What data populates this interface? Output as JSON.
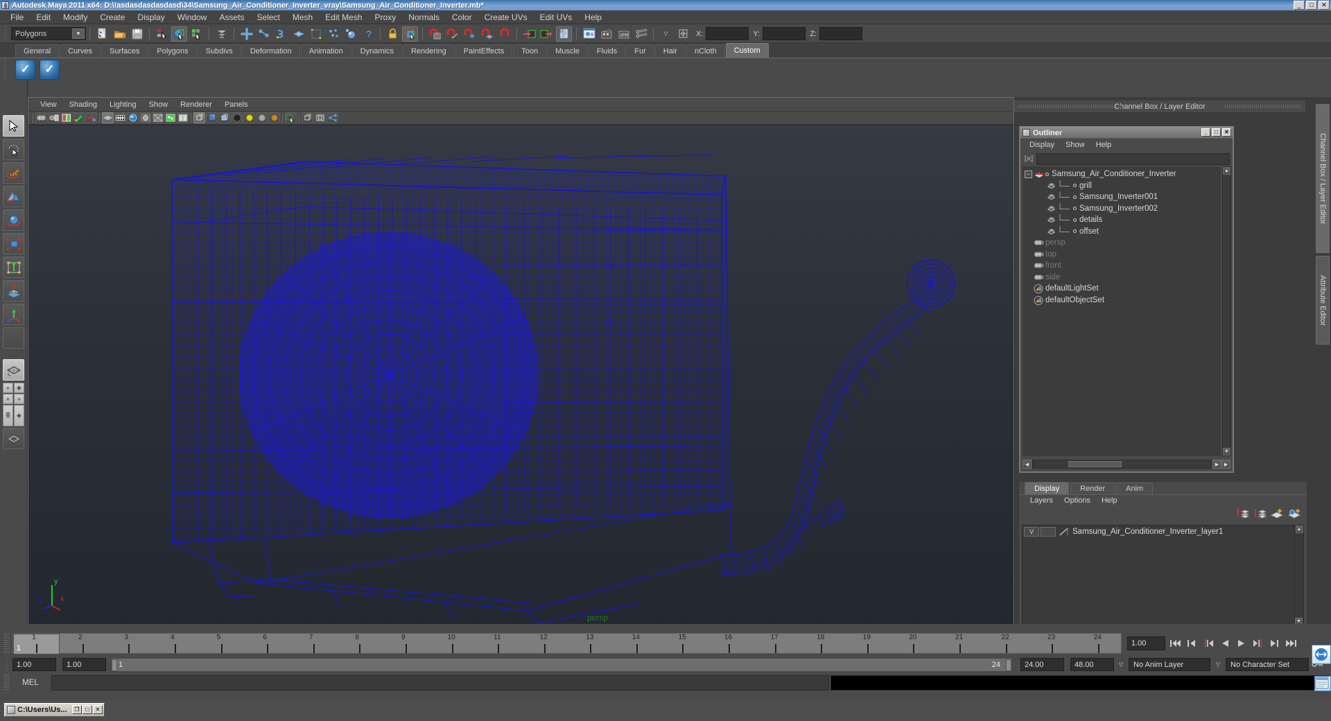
{
  "window": {
    "title": "Autodesk Maya 2011 x64: D:\\!asdasdasdasdasd\\34\\Samsung_Air_Conditioner_Inverter_vray\\Samsung_Air_Conditioner_Inverter.mb*",
    "minimize": "_",
    "maximize": "□",
    "close": "✕",
    "titlebar_color": "#4a7fb5"
  },
  "menubar": {
    "items": [
      "File",
      "Edit",
      "Modify",
      "Create",
      "Display",
      "Window",
      "Assets",
      "Select",
      "Mesh",
      "Edit Mesh",
      "Proxy",
      "Normals",
      "Color",
      "Create UVs",
      "Edit UVs",
      "Help"
    ]
  },
  "statusbar": {
    "mode_selector": {
      "value": "Polygons",
      "arrow": "▼"
    },
    "coord_labels": {
      "x": "X:",
      "y": "Y:",
      "z": "Z:"
    },
    "coord_values": {
      "x": "",
      "y": "",
      "z": ""
    },
    "icons": [
      "new-scene-icon",
      "open-scene-icon",
      "save-scene-icon",
      "select-by-hierarchy-icon",
      "select-by-object-icon",
      "select-by-component-icon",
      "select-hierarchy-mode-icon",
      "mask-handle-icon",
      "mask-joints-icon",
      "mask-curves-icon",
      "mask-surfaces-icon",
      "mask-deformations-icon",
      "mask-dynamics-icon",
      "mask-rendering-icon",
      "mask-misc-icon",
      "lock-selection-icon",
      "highlight-selection-icon",
      "snap-grid-icon",
      "snap-curve-icon",
      "snap-point-icon",
      "snap-view-plane-icon",
      "snap-live-icon",
      "input-connections-icon",
      "output-connections-icon",
      "construction-history-icon",
      "render-view-icon",
      "render-current-frame-icon",
      "ipr-render-icon",
      "render-settings-icon",
      "sidebar-toggle-icon"
    ]
  },
  "shelf": {
    "tabs": [
      "General",
      "Curves",
      "Surfaces",
      "Polygons",
      "Subdivs",
      "Deformation",
      "Animation",
      "Dynamics",
      "Rendering",
      "PaintEffects",
      "Toon",
      "Muscle",
      "Fluids",
      "Fur",
      "Hair",
      "nCloth",
      "Custom"
    ],
    "active_tab": "Custom",
    "buttons": [
      "custom-check-icon-1",
      "custom-check-icon-2"
    ],
    "button_glyph": "✓"
  },
  "toolbox": {
    "items": [
      {
        "name": "select-tool",
        "selected": true,
        "glyph": "➤"
      },
      {
        "name": "lasso-select-tool",
        "selected": false,
        "glyph": "◌"
      },
      {
        "name": "paint-select-tool",
        "selected": false,
        "glyph": "🖌"
      },
      {
        "name": "move-tool",
        "selected": false,
        "glyph": "↗"
      },
      {
        "name": "rotate-tool",
        "selected": false,
        "glyph": "⟳"
      },
      {
        "name": "scale-tool",
        "selected": false,
        "glyph": "⤢"
      },
      {
        "name": "universal-manipulator-tool",
        "selected": false,
        "glyph": "▣"
      },
      {
        "name": "soft-modification-tool",
        "selected": false,
        "glyph": "⇡"
      },
      {
        "name": "show-manipulator-tool",
        "selected": false,
        "glyph": "⊹"
      },
      {
        "name": "last-tool-used",
        "selected": false,
        "glyph": ""
      }
    ],
    "layouts": {
      "single_pane": "single-perspective-layout",
      "four_pane": "four-pane-layout",
      "outliner_persp": "outliner-persp-layout"
    }
  },
  "viewport": {
    "menus": [
      "View",
      "Shading",
      "Lighting",
      "Show",
      "Renderer",
      "Panels"
    ],
    "camera_label": "persp",
    "axis": {
      "x": "x",
      "y": "y",
      "z": "z",
      "x_color": "#cc2222",
      "y_color": "#22cc22",
      "z_color": "#2222cc"
    },
    "wireframe_color": "#1414c8",
    "background_top": "#353a45",
    "background_bottom": "#232830",
    "toolbar_icons": [
      "select-camera-icon",
      "camera-attributes-icon",
      "book-icon",
      "paint-icon",
      "keyframe-icon",
      "grid-icon",
      "film-gate-icon",
      "resolution-gate-icon",
      "gate-mask-icon",
      "xray-icon",
      "texture-icon",
      "text-icon",
      "wireframe-shaded-icon",
      "smooth-shade-all-icon",
      "smooth-shade-selected-icon",
      "flat-shade-icon",
      "hardware-texturing-icon",
      "wireframe-on-shaded-icon",
      "hardware-lighting-icon",
      "xray-mode-icon",
      "xray-joints-icon",
      "isolate-select-icon"
    ]
  },
  "right_panel": {
    "header": "Channel Box / Layer Editor",
    "tabs": [
      "Channel Box / Layer Editor",
      "Attribute Editor"
    ],
    "active_tab": "Channel Box / Layer Editor"
  },
  "outliner": {
    "title": "Outliner",
    "window_buttons": {
      "minimize": "_",
      "maximize": "□",
      "close": "✕"
    },
    "menus": [
      "Display",
      "Show",
      "Help"
    ],
    "search_value": "",
    "tree": [
      {
        "label": "Samsung_Air_Conditioner_Inverter",
        "depth": 0,
        "icon": "transform-icon",
        "expandable": true,
        "expanded": true,
        "dim": false
      },
      {
        "label": "grill",
        "depth": 1,
        "icon": "mesh-icon",
        "expandable": false,
        "dim": false
      },
      {
        "label": "Samsung_Inverter001",
        "depth": 1,
        "icon": "mesh-icon",
        "expandable": false,
        "dim": false
      },
      {
        "label": "Samsung_Inverter002",
        "depth": 1,
        "icon": "mesh-icon",
        "expandable": false,
        "dim": false
      },
      {
        "label": "details",
        "depth": 1,
        "icon": "mesh-icon",
        "expandable": false,
        "dim": false
      },
      {
        "label": "offset",
        "depth": 1,
        "icon": "mesh-icon",
        "expandable": false,
        "dim": false
      },
      {
        "label": "persp",
        "depth": 0,
        "icon": "camera-icon",
        "expandable": false,
        "dim": true
      },
      {
        "label": "top",
        "depth": 0,
        "icon": "camera-icon",
        "expandable": false,
        "dim": true
      },
      {
        "label": "front",
        "depth": 0,
        "icon": "camera-icon",
        "expandable": false,
        "dim": true
      },
      {
        "label": "side",
        "depth": 0,
        "icon": "camera-icon",
        "expandable": false,
        "dim": true
      },
      {
        "label": "defaultLightSet",
        "depth": 0,
        "icon": "set-icon",
        "expandable": false,
        "dim": false
      },
      {
        "label": "defaultObjectSet",
        "depth": 0,
        "icon": "set-icon",
        "expandable": false,
        "dim": false
      }
    ]
  },
  "layer_editor": {
    "tabs": [
      "Display",
      "Render",
      "Anim"
    ],
    "active_tab": "Display",
    "menus": [
      "Layers",
      "Options",
      "Help"
    ],
    "toolbar_icons": [
      "move-layer-up-icon",
      "move-layer-down-icon",
      "new-layer-icon",
      "new-layer-from-selected-icon"
    ],
    "layers": [
      {
        "visibility": "V",
        "playback": "",
        "name": "Samsung_Air_Conditioner_Inverter_layer1"
      }
    ]
  },
  "timeline": {
    "ticks": [
      "1",
      "2",
      "3",
      "4",
      "5",
      "6",
      "7",
      "8",
      "9",
      "10",
      "11",
      "12",
      "13",
      "14",
      "15",
      "16",
      "17",
      "18",
      "19",
      "20",
      "21",
      "22",
      "23",
      "24"
    ],
    "current_frame_label": "1",
    "current_frame_field": "1.00",
    "playback_buttons": [
      "go-to-start-icon",
      "step-back-keyframe-icon",
      "step-back-frame-icon",
      "play-backwards-icon",
      "play-forwards-icon",
      "step-forward-frame-icon",
      "step-forward-keyframe-icon",
      "go-to-end-icon"
    ]
  },
  "range_slider": {
    "anim_start": "1.00",
    "range_start": "1.00",
    "range_bar_left": "1",
    "range_bar_right": "24",
    "range_end": "24.00",
    "anim_end": "48.00",
    "anim_layer": "No Anim Layer",
    "character_set": "No Character Set",
    "anim_layer_arrow": "▽",
    "character_set_arrow": "▽",
    "key_icon": "auto-keyframe-icon",
    "prefs_icon": "animation-preferences-icon"
  },
  "command_line": {
    "label": "MEL",
    "input_value": "",
    "output_value": ""
  },
  "taskbar": {
    "item_title": "C:\\Users\\Us...",
    "buttons": {
      "restore": "❐",
      "maximize": "□",
      "close": "✕"
    }
  }
}
